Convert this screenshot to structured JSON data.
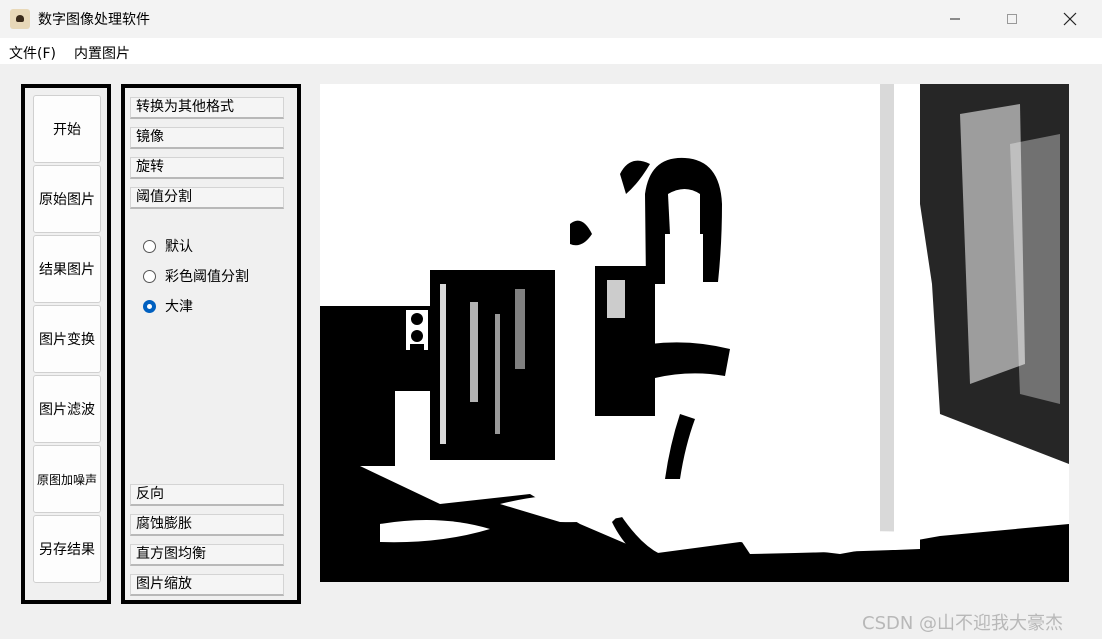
{
  "window": {
    "title": "数字图像处理软件",
    "controls": [
      "minimize",
      "maximize",
      "close"
    ]
  },
  "menubar": {
    "items": [
      "文件(F)",
      "内置图片"
    ]
  },
  "sidebar": {
    "buttons": [
      "开始",
      "原始图片",
      "结果图片",
      "图片变换",
      "图片滤波",
      "原图加噪声",
      "另存结果"
    ]
  },
  "operations": {
    "top_buttons": [
      "转换为其他格式",
      "镜像",
      "旋转",
      "阈值分割"
    ],
    "threshold_options": [
      {
        "label": "默认",
        "checked": false
      },
      {
        "label": "彩色阈值分割",
        "checked": false
      },
      {
        "label": "大津",
        "checked": true
      }
    ],
    "bottom_buttons": [
      "反向",
      "腐蚀膨胀",
      "直方图均衡",
      "图片缩放"
    ]
  },
  "watermark": "CSDN @山不迎我大豪杰",
  "colors": {
    "accent": "#0060c0",
    "panel_border": "#000000",
    "background": "#f0f0f0"
  }
}
